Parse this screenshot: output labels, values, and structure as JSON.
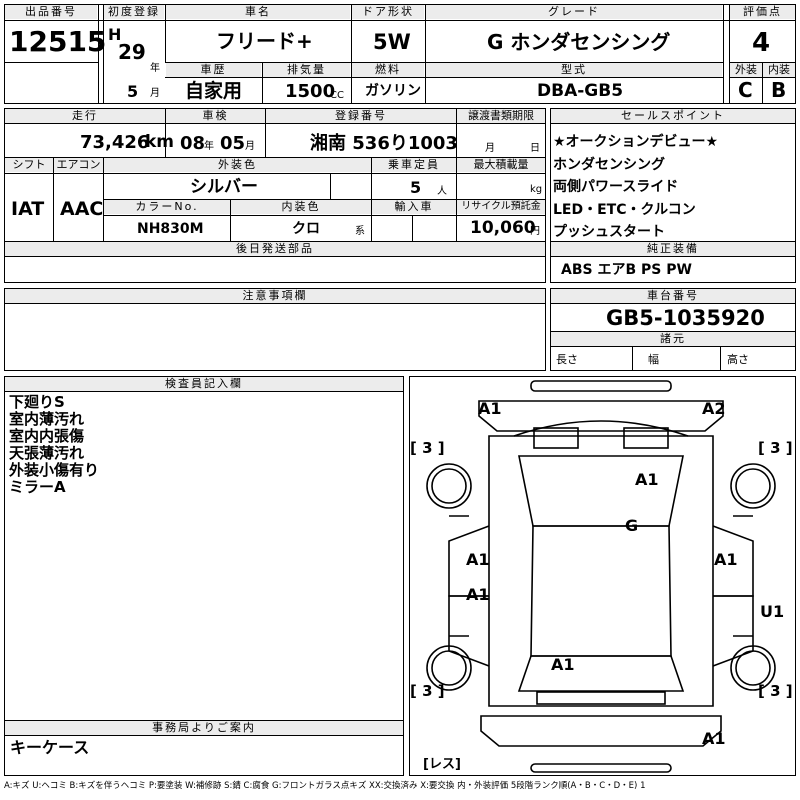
{
  "labels": {
    "lot_no": "出品番号",
    "first_reg": "初度登録",
    "car_name": "車名",
    "door": "ドア形状",
    "grade": "グレード",
    "score": "評価点",
    "history": "車歴",
    "displacement": "排気量",
    "fuel": "燃料",
    "model": "型式",
    "exterior": "外装",
    "interior": "内装",
    "mileage": "走行",
    "inspection": "車検",
    "reg_no": "登録番号",
    "transfer": "譲渡書類期限",
    "shift": "シフト",
    "ac": "エアコン",
    "ext_color": "外装色",
    "capacity": "乗車定員",
    "max_load": "最大積載量",
    "color_no": "カラーNo.",
    "int_color": "内装色",
    "import": "輸入車",
    "recycle": "リサイクル預託金",
    "later_parts": "後日発送部品",
    "sales_points": "セールスポイント",
    "genuine": "純正装備",
    "cautions": "注意事項欄",
    "chassis": "車台番号",
    "dims": "諸元",
    "length": "長さ",
    "width": "幅",
    "height": "高さ",
    "inspector": "検査員記入欄",
    "office": "事務局よりご案内"
  },
  "units": {
    "year": "年",
    "month": "月",
    "cc": "CC",
    "km": "km",
    "people": "人",
    "kg": "kg",
    "yen": "円",
    "inspection_year": "年",
    "inspection_month": "月",
    "kei": "系",
    "transfer_month": "月",
    "transfer_day": "日"
  },
  "values": {
    "lot_no": "12515",
    "era": "H",
    "year": "29",
    "month": "5",
    "car_name": "フリード+",
    "door": "5W",
    "grade": "G ホンダセンシング",
    "score": "4",
    "history": "自家用",
    "displacement": "1500",
    "fuel": "ガソリン",
    "model": "DBA-GB5",
    "exterior": "C",
    "interior": "B",
    "mileage": "73,426",
    "inspection_y": "08",
    "inspection_m": "05",
    "reg_no": "湘南 536り1003",
    "shift": "IAT",
    "ac": "AAC",
    "ext_color": "シルバー",
    "capacity": "5",
    "color_no": "NH830M",
    "int_color": "クロ",
    "recycle": "10,060",
    "chassis": "GB5-1035920",
    "genuine": "ABS エアB PS PW"
  },
  "sales_points": [
    "★オークションデビュー★",
    "ホンダセンシング",
    "両側パワースライド",
    "LED・ETC・クルコン",
    "プッシュスタート"
  ],
  "inspector_notes": [
    "下廻りS",
    "室内薄汚れ",
    "室内内張傷",
    "天張薄汚れ",
    "外装小傷有り",
    "ミラーA"
  ],
  "office_note": "キーケース",
  "diagram_marks": [
    "A1",
    "A2",
    "A1",
    "G",
    "A1",
    "A1",
    "A1",
    "U1",
    "A1",
    "A1"
  ],
  "tire_marks": [
    "[ 3 ]",
    "[ 3 ]",
    "[ 3 ]",
    "[ 3 ]"
  ],
  "spare_tire": "[レス]",
  "legend": "A:キズ U:ヘコミ B:キズを伴うヘコミ P:要塗装 W:補修跡 S:錆 C:腐食 G:フロントガラス点キズ XX:交換済み X:要交換 内・外装評価 5段階ランク順(A・B・C・D・E) 1"
}
